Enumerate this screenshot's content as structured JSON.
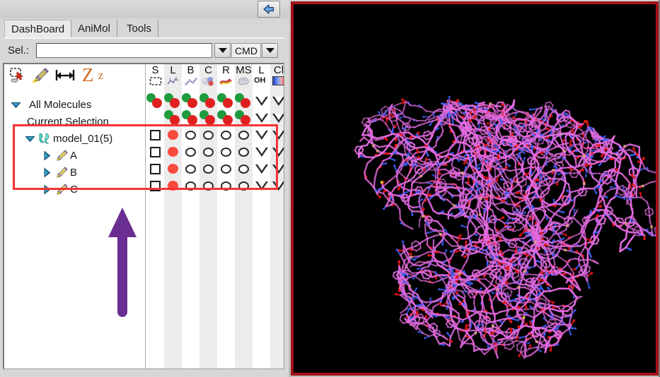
{
  "app": {
    "title_strip": "",
    "collapse_icon": "double-chevron-left-icon"
  },
  "tabs": [
    {
      "label": "DashBoard",
      "active": true
    },
    {
      "label": "AniMol",
      "active": false
    },
    {
      "label": "Tools",
      "active": false
    }
  ],
  "selection_bar": {
    "label": "Sel.:",
    "input_value": "",
    "input_placeholder": "",
    "dropdown_icon": "chevron-down-icon",
    "mode_label": "CMD",
    "mode_dropdown_icon": "chevron-down-icon"
  },
  "tree_toolbar": {
    "icons": [
      {
        "name": "select-rectangle-icon",
        "label": ""
      },
      {
        "name": "highlighter-pen-icon",
        "label": ""
      },
      {
        "name": "measure-distance-icon",
        "label": ""
      },
      {
        "name": "zoom-in-z-icon",
        "label": "Z"
      },
      {
        "name": "zoom-out-z-icon",
        "label": "z"
      }
    ]
  },
  "grid_columns": [
    {
      "letter": "S",
      "glyph": "selection-box-icon"
    },
    {
      "letter": "L",
      "glyph": "lines-icon"
    },
    {
      "letter": "B",
      "glyph": "ball-stick-icon"
    },
    {
      "letter": "C",
      "glyph": "cpk-spheres-icon"
    },
    {
      "letter": "R",
      "glyph": "ribbon-icon"
    },
    {
      "letter": "MS",
      "glyph": "molecular-surface-icon"
    },
    {
      "letter": "L",
      "glyph": "label-oh-icon"
    },
    {
      "letter": "Cl",
      "glyph": "color-ramp-icon"
    }
  ],
  "tree_rows": [
    {
      "label": "All Molecules",
      "indent": 0,
      "twist": "expanded",
      "item_icon": "none",
      "controls": [
        "pair",
        "pair",
        "pair",
        "pair",
        "pair",
        "pair",
        "triangle",
        "triangle"
      ],
      "highlighted": false
    },
    {
      "label": "Current Selection",
      "indent": 1,
      "twist": "none",
      "item_icon": "none",
      "controls": [
        "none",
        "pair",
        "pair",
        "pair",
        "pair",
        "pair",
        "triangle",
        "triangle"
      ],
      "highlighted": false
    },
    {
      "label": "model_01(5)",
      "indent": 1,
      "twist": "expanded",
      "item_icon": "ribbon-molecule-icon",
      "controls": [
        "checkbox",
        "red-dot",
        "ring",
        "ring",
        "ring",
        "ring",
        "triangle",
        "triangle"
      ],
      "highlighted": true
    },
    {
      "label": "A",
      "indent": 2,
      "twist": "collapsed",
      "item_icon": "chain-icon",
      "controls": [
        "checkbox",
        "red-dot",
        "ring",
        "ring",
        "ring",
        "ring",
        "triangle",
        "triangle"
      ],
      "highlighted": true
    },
    {
      "label": "B",
      "indent": 2,
      "twist": "collapsed",
      "item_icon": "chain-icon",
      "controls": [
        "checkbox",
        "red-dot",
        "ring",
        "ring",
        "ring",
        "ring",
        "triangle",
        "triangle"
      ],
      "highlighted": true
    },
    {
      "label": "C",
      "indent": 2,
      "twist": "collapsed",
      "item_icon": "chain-icon",
      "controls": [
        "checkbox",
        "red-dot",
        "ring",
        "ring",
        "ring",
        "ring",
        "triangle",
        "triangle"
      ],
      "highlighted": true
    }
  ],
  "annotations": {
    "highlight_box": {
      "name": "red-highlight-box",
      "color": "#f53333"
    },
    "arrow": {
      "name": "purple-up-arrow",
      "color": "#6a2d91",
      "direction": "up"
    }
  },
  "viewer": {
    "name": "molecule-3d-viewport",
    "background": "#000000",
    "border_color": "#a51118",
    "representation": "wireframe-sticks",
    "colors": {
      "carbon": "#e36ae0",
      "nitrogen": "#3a5cf0",
      "oxygen": "#e21414",
      "sulfur": "#d8d820"
    }
  }
}
